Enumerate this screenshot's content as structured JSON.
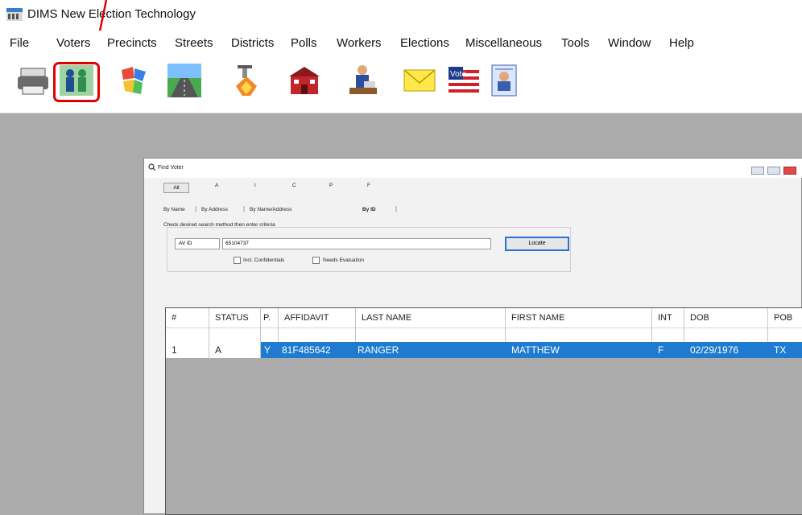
{
  "app": {
    "title": "DIMS New Election Technology"
  },
  "menu": [
    "File",
    "Voters",
    "Precincts",
    "Streets",
    "Districts",
    "Polls",
    "Workers",
    "Elections",
    "Miscellaneous",
    "Tools",
    "Window",
    "Help"
  ],
  "toolbar": {
    "icons": [
      "printer-icon",
      "voters-icon",
      "districts-icon",
      "streets-icon",
      "polls-icon",
      "elections-icon",
      "workers-icon",
      "mail-icon",
      "vote-flag-icon",
      "report-icon"
    ]
  },
  "find_voter": {
    "title": "Find Voter",
    "letter_tabs": [
      "All",
      "A",
      "I",
      "C",
      "P",
      "F"
    ],
    "sub_tabs": [
      "By Name",
      "By Address",
      "By Name/Address",
      "By ID"
    ],
    "group_label": "Check desired search method then enter criteria",
    "search_type": "AV ID",
    "id_value": "65104737",
    "locate_label": "Locate",
    "checkbox_confidentials": "Incl. Confidentials",
    "checkbox_evaluation": "Needs Evaluation"
  },
  "grid": {
    "columns": [
      "#",
      "STATUS",
      "P.",
      "AFFIDAVIT",
      "LAST NAME",
      "FIRST NAME",
      "INT",
      "DOB",
      "POB"
    ],
    "rows": [
      {
        "num": "1",
        "status": "A",
        "p": "Y",
        "affidavit": "81F485642",
        "last_name": "RANGER",
        "first_name": "MATTHEW",
        "int": "F",
        "dob": "02/29/1976",
        "pob": "TX"
      }
    ]
  },
  "colors": {
    "annotation": "#e00000",
    "selection": "#1e7bd0"
  }
}
